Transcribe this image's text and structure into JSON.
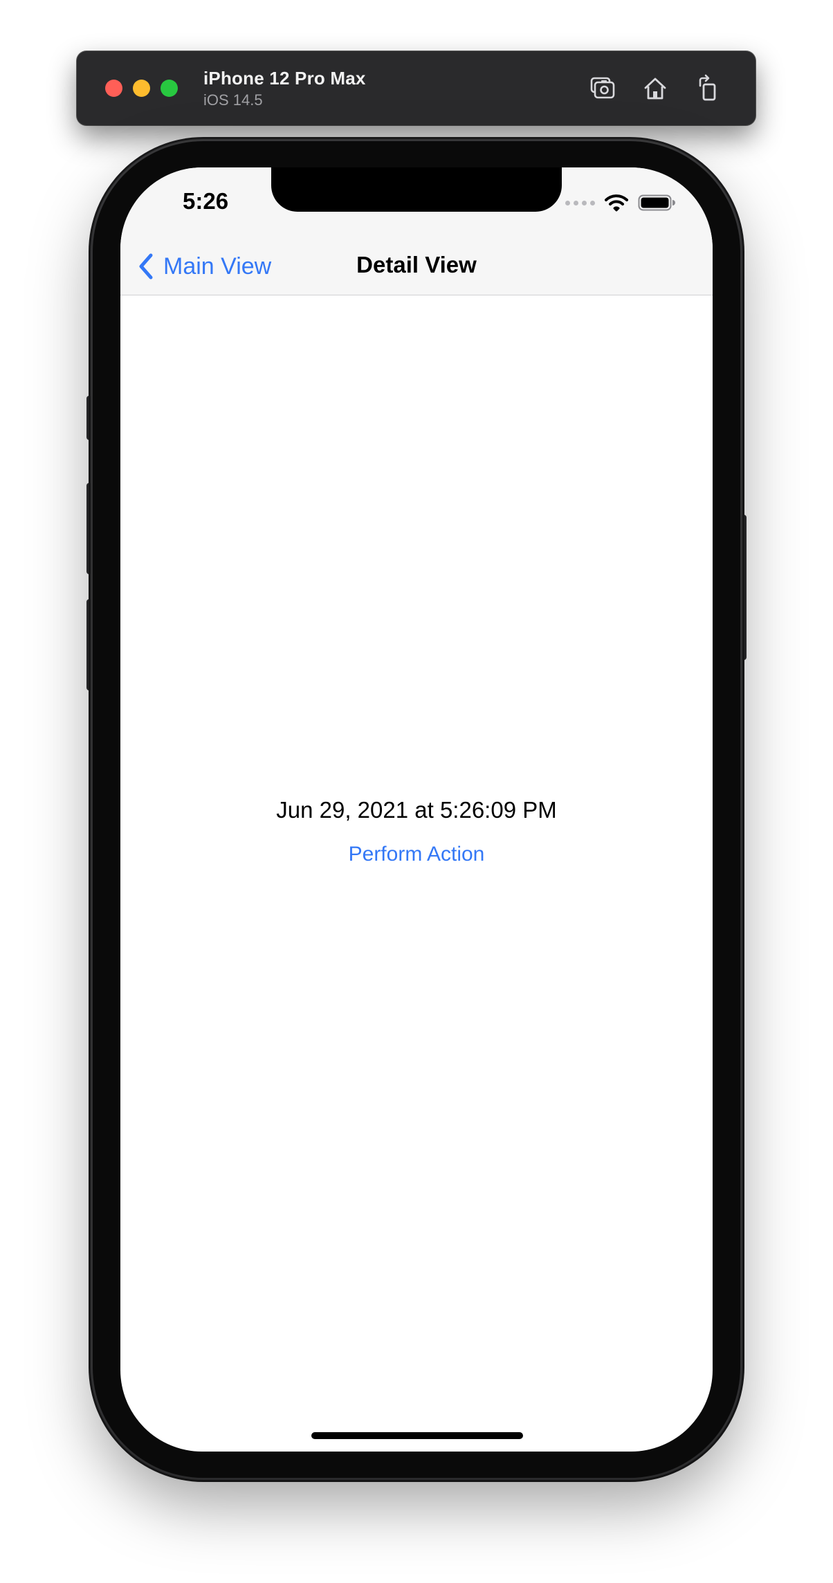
{
  "simulator": {
    "device_name": "iPhone 12 Pro Max",
    "os_version": "iOS 14.5",
    "toolbar": {
      "screenshot_icon": "camera-icon",
      "home_icon": "home-icon",
      "rotate_icon": "rotate-icon"
    }
  },
  "status_bar": {
    "time": "5:26",
    "wifi_icon": "wifi-icon",
    "battery_icon": "battery-icon"
  },
  "navigation": {
    "back_label": "Main View",
    "back_icon": "chevron-left-icon",
    "title": "Detail View"
  },
  "content": {
    "timestamp": "Jun 29, 2021 at 5:26:09 PM",
    "action_label": "Perform Action"
  },
  "colors": {
    "accent": "#3478f6",
    "nav_background": "#f6f6f6",
    "titlebar": "#2a2a2c"
  }
}
